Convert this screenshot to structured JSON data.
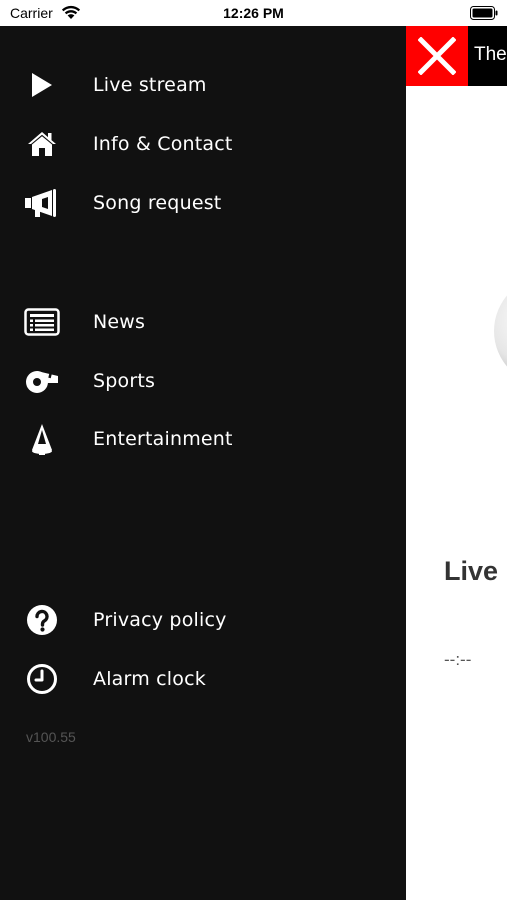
{
  "status_bar": {
    "carrier": "Carrier",
    "time": "12:26 PM",
    "icons": [
      "wifi-icon",
      "battery-icon"
    ]
  },
  "drawer": {
    "background": "#111111",
    "items": [
      {
        "label": "Live stream",
        "icon": "play-icon"
      },
      {
        "label": "Info & Contact",
        "icon": "home-icon"
      },
      {
        "label": "Song request",
        "icon": "megaphone-icon"
      },
      {
        "label": "News",
        "icon": "newspaper-icon"
      },
      {
        "label": "Sports",
        "icon": "whistle-icon"
      },
      {
        "label": "Entertainment",
        "icon": "spotlight-icon"
      },
      {
        "label": "Privacy policy",
        "icon": "question-icon"
      },
      {
        "label": "Alarm clock",
        "icon": "clock-icon"
      }
    ],
    "version": "v100.55"
  },
  "content": {
    "close_button_color": "#ff0000",
    "header_title": "The",
    "live_title": "Live",
    "time_display": "--:--"
  }
}
